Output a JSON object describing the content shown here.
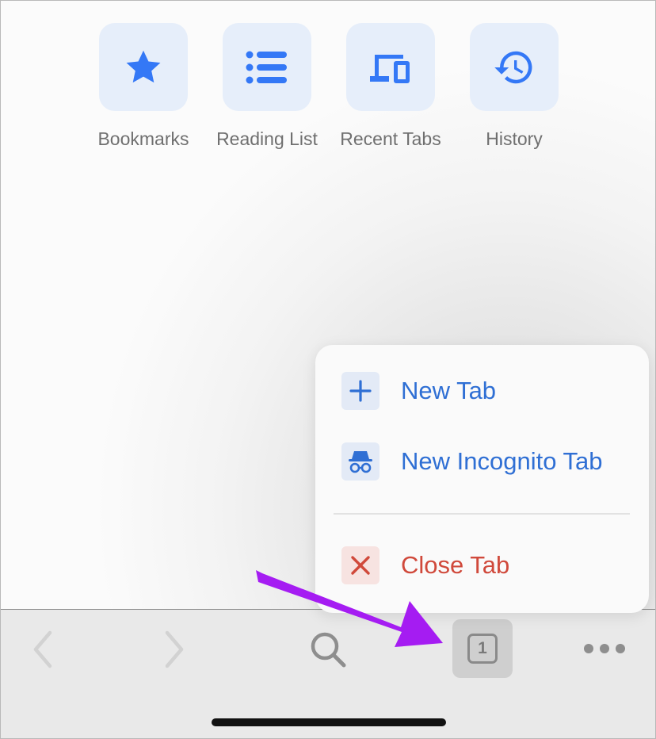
{
  "shortcuts": [
    {
      "label": "Bookmarks",
      "icon": "star-icon"
    },
    {
      "label": "Reading List",
      "icon": "list-icon"
    },
    {
      "label": "Recent Tabs",
      "icon": "devices-icon"
    },
    {
      "label": "History",
      "icon": "history-icon"
    }
  ],
  "menu": {
    "items": [
      {
        "label": "New Tab",
        "icon": "plus-icon"
      },
      {
        "label": "New Incognito Tab",
        "icon": "incognito-icon"
      },
      {
        "label": "Close Tab",
        "icon": "close-icon"
      }
    ]
  },
  "toolbar": {
    "tab_count": "1",
    "back_icon": "chevron-left-icon",
    "forward_icon": "chevron-right-icon",
    "search_icon": "search-icon",
    "more_icon": "more-dots-icon"
  },
  "colors": {
    "accent_blue": "#2f6fd4",
    "icon_blue": "#3478f6",
    "danger_red": "#d0493b",
    "annotation_arrow": "#a51cf2"
  }
}
